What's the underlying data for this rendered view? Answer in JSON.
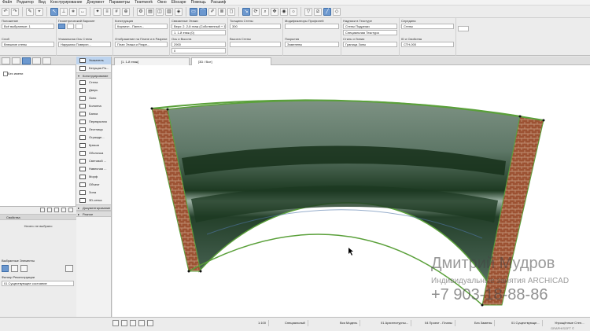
{
  "menu": [
    "Файл",
    "Редактор",
    "Вид",
    "Конструирование",
    "Документ",
    "Параметры",
    "Teamwork",
    "Окно",
    "Eliscape",
    "Помощь",
    "Расшиф"
  ],
  "infobox": {
    "g1": {
      "label": "Положение",
      "value": "Всё выбранные: 1",
      "row2_label": "Слой",
      "row2_value": "Внешние стены"
    },
    "g2": {
      "label": "Геометрический Вариант",
      "row2_label": "Уникальная Ось Стены",
      "row2_value": "Наружная Поверхн..."
    },
    "g3": {
      "label": "Конструкция",
      "value": "Кирпичн - Панел...",
      "row2_label": "Отображение на Плане и в Разрезе",
      "row2_value": "План Этажа и Разре..."
    },
    "g4": {
      "label": "Связанные Этажи",
      "value": "Верх: 2. 2-й этаж (Собственный + 1)",
      "value2": "1. 1-й этаж (0)",
      "row2_label": "Ось и Высота",
      "row2_value": "2900",
      "row2_value2": "0"
    },
    "g5": {
      "label": "Толщина Стены",
      "value": "300",
      "row2_label": "Высота Стены"
    },
    "g6": {
      "label": "Модификаторы Профилей",
      "row2_label": "Покрытия",
      "row2_value": "Заменены"
    },
    "g7": {
      "label": "Надписи в Текстуре",
      "value": "Стены Подрезки",
      "value2": "Специальная Текстура",
      "row2_label": "Стиль и Линии",
      "row2_value": "Граница Зоны"
    },
    "g8": {
      "label": "Середина",
      "value": "Стены",
      "row2_label": "ID и Свойства",
      "row2_value": "СТН-000"
    }
  },
  "tabs": {
    "plan": "[1. 1-й этаж]",
    "view3d": "[3D / Все]"
  },
  "navigator": {
    "root": "Без имени"
  },
  "toolbox": {
    "selector": "Указатель",
    "marquee": "Бегущая Ра...",
    "design_head": "Конструирование",
    "tools": [
      "Стена",
      "Дверь",
      "Окно",
      "Колонна",
      "Балка",
      "Перекрытия",
      "Лестница",
      "Огражде...",
      "Крыша",
      "Оболочка",
      "Световой ...",
      "Навесная ...",
      "Морф",
      "Объект",
      "Зона",
      "3D-сетка"
    ],
    "doc_head": "Документирование",
    "more_head": "Разное"
  },
  "properties": {
    "title": "Свойства",
    "selected": "Ничего не выбрано",
    "elements": "Выбранные Элементы",
    "filter": "Фильтр Реконструкции",
    "filter_value": "01 Существующее состояние"
  },
  "watermark": {
    "name": "Дмитрий Мудров",
    "subtitle": "Индивидуальные занятия ARCHICAD",
    "phone": "+7 903-18-88-86"
  },
  "status": {
    "zoom": "1:100",
    "special": "Специальный",
    "model": "Вся Модель",
    "design": "01 Архитектурны...",
    "project": "04 Проект - Планы",
    "noreplace": "Без Замены",
    "exist": "01 Существующе...",
    "surfaces": "Упрощённые Стен...",
    "brand": "GRAPHISOFT ©"
  }
}
